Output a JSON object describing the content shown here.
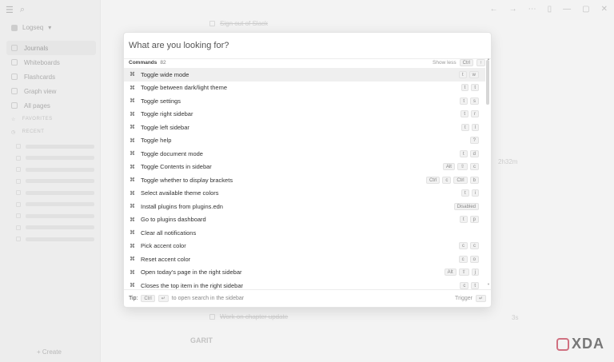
{
  "sidebar": {
    "graph_name": "Logseq",
    "nav": [
      {
        "label": "Journals",
        "icon": "calendar-icon"
      },
      {
        "label": "Whiteboards",
        "icon": "whiteboard-icon"
      },
      {
        "label": "Flashcards",
        "icon": "flashcards-icon"
      },
      {
        "label": "Graph view",
        "icon": "graph-icon"
      },
      {
        "label": "All pages",
        "icon": "pages-icon"
      }
    ],
    "favorites_label": "FAVORITES",
    "recent_label": "RECENT",
    "create_label": "+ Create"
  },
  "background": {
    "task_top": "Sign out of Slack",
    "task_bottom": "Work on chapter update",
    "time_1": "2h32m",
    "time_2": "3s",
    "section": "GARIT"
  },
  "search": {
    "placeholder": "What are you looking for?"
  },
  "group": {
    "title": "Commands",
    "count": "82",
    "show_less": "Show less",
    "shortcut": [
      "Ctrl",
      "↑"
    ]
  },
  "commands": [
    {
      "label": "Toggle wide mode",
      "keys": [
        "t",
        "w"
      ],
      "active": true
    },
    {
      "label": "Toggle between dark/light theme",
      "keys": [
        "t",
        "t"
      ]
    },
    {
      "label": "Toggle settings",
      "keys": [
        "t",
        "s"
      ]
    },
    {
      "label": "Toggle right sidebar",
      "keys": [
        "t",
        "r"
      ]
    },
    {
      "label": "Toggle left sidebar",
      "keys": [
        "t",
        "l"
      ]
    },
    {
      "label": "Toggle help",
      "keys": [
        "?"
      ]
    },
    {
      "label": "Toggle document mode",
      "keys": [
        "t",
        "d"
      ]
    },
    {
      "label": "Toggle Contents in sidebar",
      "keys": [
        "Alt",
        "⇧",
        "c"
      ]
    },
    {
      "label": "Toggle whether to display brackets",
      "keys": [
        "Ctrl",
        "c",
        "Ctrl",
        "b"
      ]
    },
    {
      "label": "Select available theme colors",
      "keys": [
        "t",
        "i"
      ]
    },
    {
      "label": "Install plugins from plugins.edn",
      "keys": [
        "Disabled"
      ]
    },
    {
      "label": "Go to plugins dashboard",
      "keys": [
        "t",
        "p"
      ]
    },
    {
      "label": "Clear all notifications",
      "keys": []
    },
    {
      "label": "Pick accent color",
      "keys": [
        "c",
        "c"
      ]
    },
    {
      "label": "Reset accent color",
      "keys": [
        "c",
        "o"
      ]
    },
    {
      "label": "Open today's page in the right sidebar",
      "keys": [
        "Alt",
        "⇧",
        "j"
      ]
    },
    {
      "label": "Closes the top item in the right sidebar",
      "keys": [
        "c",
        "t"
      ]
    }
  ],
  "footer": {
    "tip_label": "Tip:",
    "tip_keys": [
      "Ctrl",
      "↵"
    ],
    "tip_text": "to open search in the sidebar",
    "trigger": "Trigger",
    "trigger_key": "↵"
  },
  "watermark": "XDA"
}
